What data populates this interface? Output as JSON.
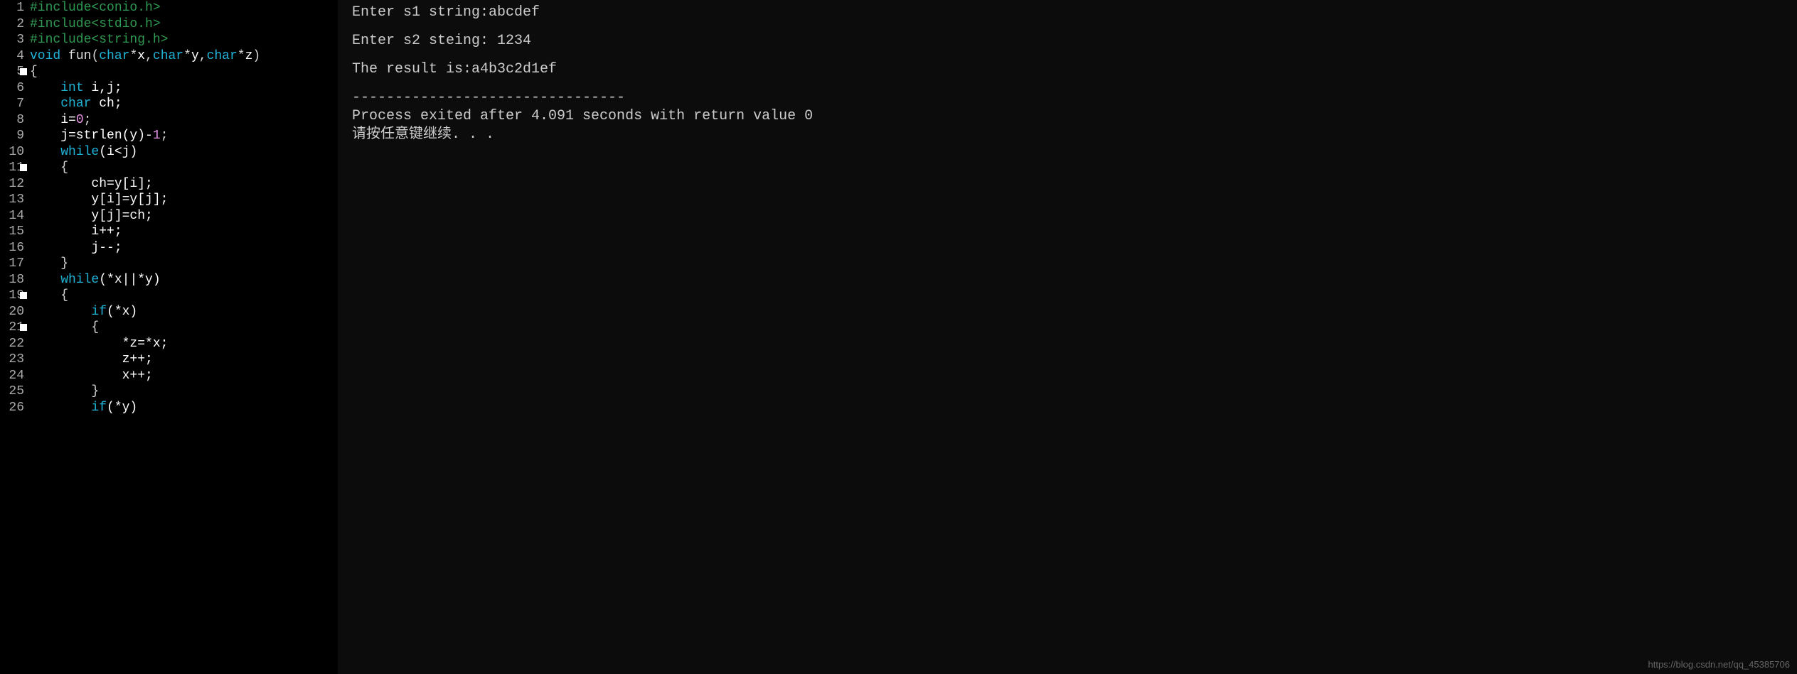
{
  "editor": {
    "lines": [
      {
        "n": 1,
        "fold": false,
        "tokens": [
          {
            "t": "#include<conio.h>",
            "c": "tk-include"
          }
        ]
      },
      {
        "n": 2,
        "fold": false,
        "tokens": [
          {
            "t": "#include<stdio.h>",
            "c": "tk-include"
          }
        ]
      },
      {
        "n": 3,
        "fold": false,
        "tokens": [
          {
            "t": "#include<string.h>",
            "c": "tk-include"
          }
        ]
      },
      {
        "n": 4,
        "fold": false,
        "tokens": [
          {
            "t": "void",
            "c": "tk-keyword"
          },
          {
            "t": " ",
            "c": ""
          },
          {
            "t": "fun",
            "c": "tk-func"
          },
          {
            "t": "(",
            "c": "tk-paren"
          },
          {
            "t": "char",
            "c": "tk-keyword"
          },
          {
            "t": "*",
            "c": "tk-op"
          },
          {
            "t": "x",
            "c": "tk-ident"
          },
          {
            "t": ",",
            "c": "tk-punct"
          },
          {
            "t": "char",
            "c": "tk-keyword"
          },
          {
            "t": "*",
            "c": "tk-op"
          },
          {
            "t": "y",
            "c": "tk-ident"
          },
          {
            "t": ",",
            "c": "tk-punct"
          },
          {
            "t": "char",
            "c": "tk-keyword"
          },
          {
            "t": "*",
            "c": "tk-op"
          },
          {
            "t": "z",
            "c": "tk-ident"
          },
          {
            "t": ")",
            "c": "tk-paren"
          }
        ]
      },
      {
        "n": 5,
        "fold": true,
        "tokens": [
          {
            "t": "{",
            "c": "tk-punct"
          }
        ]
      },
      {
        "n": 6,
        "fold": false,
        "tokens": [
          {
            "t": "    ",
            "c": ""
          },
          {
            "t": "int",
            "c": "tk-keyword"
          },
          {
            "t": " i,j;",
            "c": "tk-ident"
          }
        ]
      },
      {
        "n": 7,
        "fold": false,
        "tokens": [
          {
            "t": "    ",
            "c": ""
          },
          {
            "t": "char",
            "c": "tk-keyword"
          },
          {
            "t": " ch;",
            "c": "tk-ident"
          }
        ]
      },
      {
        "n": 8,
        "fold": false,
        "tokens": [
          {
            "t": "    i=",
            "c": "tk-ident"
          },
          {
            "t": "0",
            "c": "tk-num"
          },
          {
            "t": ";",
            "c": "tk-punct"
          }
        ]
      },
      {
        "n": 9,
        "fold": false,
        "tokens": [
          {
            "t": "    j=strlen(y)-",
            "c": "tk-ident"
          },
          {
            "t": "1",
            "c": "tk-num"
          },
          {
            "t": ";",
            "c": "tk-punct"
          }
        ]
      },
      {
        "n": 10,
        "fold": false,
        "tokens": [
          {
            "t": "    ",
            "c": ""
          },
          {
            "t": "while",
            "c": "tk-keyword"
          },
          {
            "t": "(i<j)",
            "c": "tk-ident"
          }
        ]
      },
      {
        "n": 11,
        "fold": true,
        "tokens": [
          {
            "t": "    {",
            "c": "tk-punct"
          }
        ]
      },
      {
        "n": 12,
        "fold": false,
        "tokens": [
          {
            "t": "        ch=y[i];",
            "c": "tk-ident"
          }
        ]
      },
      {
        "n": 13,
        "fold": false,
        "tokens": [
          {
            "t": "        y[i]=y[j];",
            "c": "tk-ident"
          }
        ]
      },
      {
        "n": 14,
        "fold": false,
        "tokens": [
          {
            "t": "        y[j]=ch;",
            "c": "tk-ident"
          }
        ]
      },
      {
        "n": 15,
        "fold": false,
        "tokens": [
          {
            "t": "        i++;",
            "c": "tk-ident"
          }
        ]
      },
      {
        "n": 16,
        "fold": false,
        "tokens": [
          {
            "t": "        j--;",
            "c": "tk-ident"
          }
        ]
      },
      {
        "n": 17,
        "fold": false,
        "tokens": [
          {
            "t": "    }",
            "c": "tk-punct"
          }
        ]
      },
      {
        "n": 18,
        "fold": false,
        "tokens": [
          {
            "t": "    ",
            "c": ""
          },
          {
            "t": "while",
            "c": "tk-keyword"
          },
          {
            "t": "(*x||*y)",
            "c": "tk-ident"
          }
        ]
      },
      {
        "n": 19,
        "fold": true,
        "tokens": [
          {
            "t": "    {",
            "c": "tk-punct"
          }
        ]
      },
      {
        "n": 20,
        "fold": false,
        "tokens": [
          {
            "t": "        ",
            "c": ""
          },
          {
            "t": "if",
            "c": "tk-keyword"
          },
          {
            "t": "(*x)",
            "c": "tk-ident"
          }
        ]
      },
      {
        "n": 21,
        "fold": true,
        "tokens": [
          {
            "t": "        {",
            "c": "tk-punct"
          }
        ]
      },
      {
        "n": 22,
        "fold": false,
        "tokens": [
          {
            "t": "            *z=*x;",
            "c": "tk-ident"
          }
        ]
      },
      {
        "n": 23,
        "fold": false,
        "tokens": [
          {
            "t": "            z++;",
            "c": "tk-ident"
          }
        ]
      },
      {
        "n": 24,
        "fold": false,
        "tokens": [
          {
            "t": "            x++;",
            "c": "tk-ident"
          }
        ]
      },
      {
        "n": 25,
        "fold": false,
        "tokens": [
          {
            "t": "        }",
            "c": "tk-punct"
          }
        ]
      },
      {
        "n": 26,
        "fold": false,
        "tokens": [
          {
            "t": "        ",
            "c": ""
          },
          {
            "t": "if",
            "c": "tk-keyword"
          },
          {
            "t": "(*y)",
            "c": "tk-ident"
          }
        ]
      }
    ]
  },
  "console": {
    "l1": "Enter s1 string:abcdef",
    "l2": "Enter s2 steing: 1234",
    "l3": "The result is:a4b3c2d1ef",
    "sep": "--------------------------------",
    "l4": "Process exited after 4.091 seconds with return value 0",
    "l5": "请按任意键继续. . ."
  },
  "watermark": "https://blog.csdn.net/qq_45385706"
}
